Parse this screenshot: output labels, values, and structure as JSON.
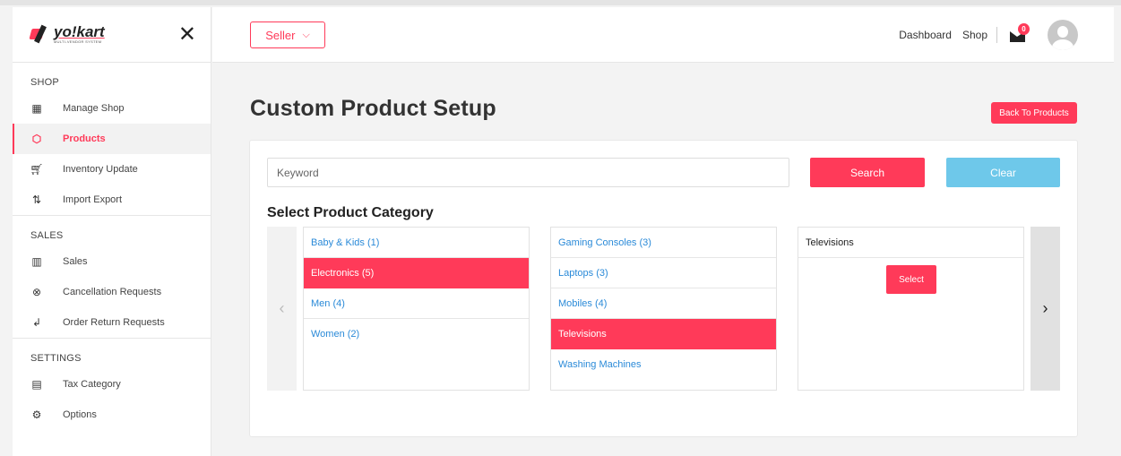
{
  "brand": {
    "name": "yo!kart",
    "tagline": "MULTI-VENDOR SYSTEM"
  },
  "sidebar": {
    "sections": [
      {
        "title": "SHOP",
        "items": [
          {
            "label": "Manage Shop",
            "icon": "shop-icon"
          },
          {
            "label": "Products",
            "icon": "box-icon",
            "active": true
          },
          {
            "label": "Inventory Update",
            "icon": "cart-icon"
          },
          {
            "label": "Import Export",
            "icon": "arrows-updown-icon"
          }
        ]
      },
      {
        "title": "SALES",
        "items": [
          {
            "label": "Sales",
            "icon": "bar-chart-icon"
          },
          {
            "label": "Cancellation Requests",
            "icon": "cancel-circle-icon"
          },
          {
            "label": "Order Return Requests",
            "icon": "return-arrow-icon"
          }
        ]
      },
      {
        "title": "SETTINGS",
        "items": [
          {
            "label": "Tax Category",
            "icon": "tax-icon"
          },
          {
            "label": "Options",
            "icon": "gear-icon"
          }
        ]
      }
    ]
  },
  "header": {
    "role_label": "Seller",
    "links": {
      "dashboard": "Dashboard",
      "shop": "Shop"
    },
    "message_count": "0"
  },
  "main": {
    "title": "Custom Product Setup",
    "back_label": "Back To Products",
    "keyword_placeholder": "Keyword",
    "search_label": "Search",
    "clear_label": "Clear",
    "category_heading": "Select Product Category",
    "categories_level1": [
      "Baby & Kids (1)",
      "Electronics (5)",
      "Men (4)",
      "Women (2)"
    ],
    "categories_level2": [
      "Gaming Consoles (3)",
      "Laptops (3)",
      "Mobiles (4)",
      "Televisions",
      "Washing Machines"
    ],
    "selected_category": "Televisions",
    "select_label": "Select",
    "arrow_left": "‹",
    "arrow_right": "›"
  },
  "colors": {
    "accent": "#ff3a59",
    "clear": "#6ec8ea",
    "link": "#2a8ad8"
  }
}
